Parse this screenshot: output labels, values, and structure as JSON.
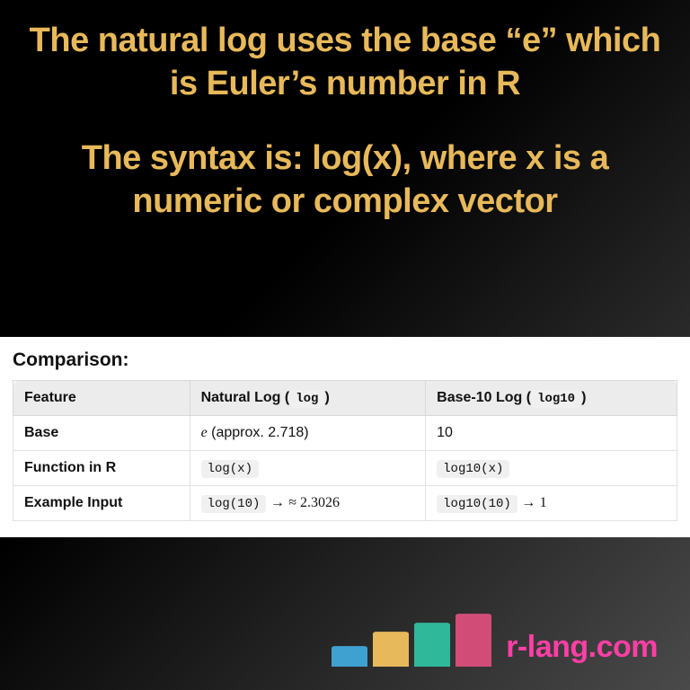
{
  "headings": {
    "line1": "The natural log uses the base “e” which is Euler’s number in R",
    "line2": "The syntax is: log(x), where x is a numeric or complex vector"
  },
  "comparison": {
    "title": "Comparison:",
    "headers": {
      "feature": "Feature",
      "nat_prefix": "Natural Log (",
      "nat_code": "log",
      "nat_suffix": ")",
      "b10_prefix": "Base-10 Log (",
      "b10_code": "log10",
      "b10_suffix": ")"
    },
    "rows": {
      "base": {
        "feature": "Base",
        "nat_e": "e",
        "nat_tail": " (approx. 2.718)",
        "b10": "10"
      },
      "func": {
        "feature": "Function in R",
        "nat_code": "log(x)",
        "b10_code": "log10(x)"
      },
      "example": {
        "feature": "Example Input",
        "nat_code": "log(10)",
        "nat_arrow": " → ",
        "nat_result": "≈ 2.3026",
        "b10_code": "log10(10)",
        "b10_arrow": " → ",
        "b10_result": "1"
      }
    }
  },
  "footer": {
    "brand": "r-lang.com"
  },
  "chart_data": {
    "type": "table",
    "title": "Comparison:",
    "columns": [
      "Feature",
      "Natural Log (log)",
      "Base-10 Log (log10)"
    ],
    "rows": [
      [
        "Base",
        "e (approx. 2.718)",
        "10"
      ],
      [
        "Function in R",
        "log(x)",
        "log10(x)"
      ],
      [
        "Example Input",
        "log(10) → ≈ 2.3026",
        "log10(10) → 1"
      ]
    ]
  }
}
